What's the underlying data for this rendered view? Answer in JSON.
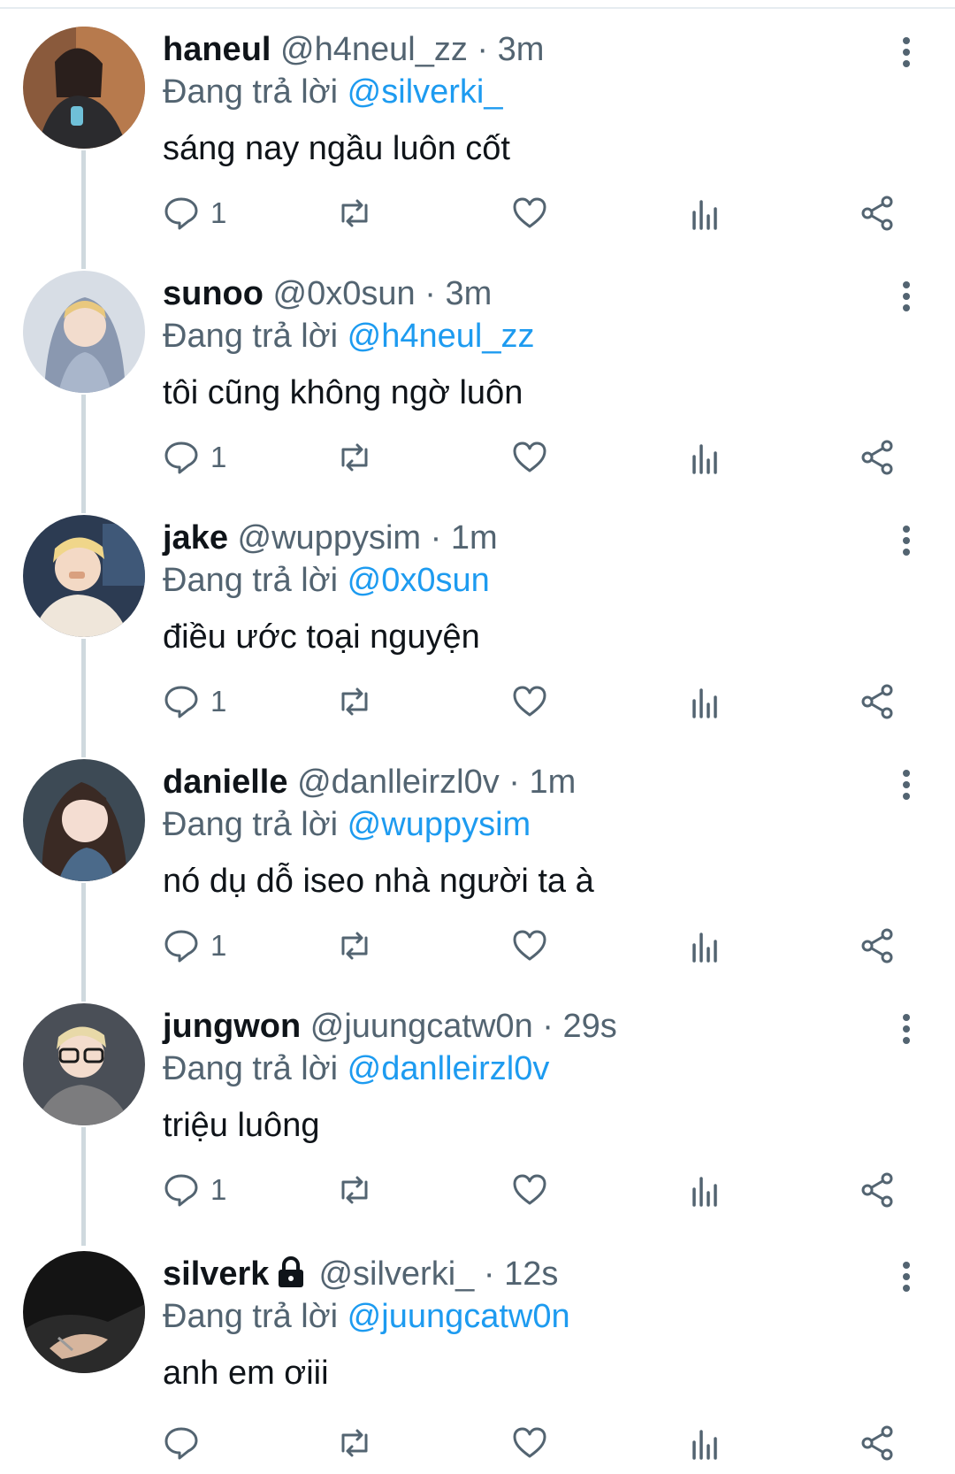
{
  "colors": {
    "accent": "#1d9bf0",
    "secondary_text": "#536471",
    "thread_line": "#cfd9de"
  },
  "icons": {
    "reply": "speech-bubble-icon",
    "retweet": "retweet-icon",
    "like": "heart-icon",
    "views": "bar-chart-icon",
    "share": "share-icon",
    "more": "vertical-dots-icon",
    "lock": "lock-icon"
  },
  "replying_prefix": "Đang trả lời",
  "replies": [
    {
      "name": "haneul",
      "handle": "@h4neul_zz",
      "sep": "·",
      "time": "3m",
      "replying_to": "@silverki_",
      "text": "sáng nay ngầu luôn cốt",
      "reply_count": "1"
    },
    {
      "name": "sunoo",
      "handle": "@0x0sun",
      "sep": "·",
      "time": "3m",
      "replying_to": "@h4neul_zz",
      "text": "tôi cũng không ngờ luôn",
      "reply_count": "1"
    },
    {
      "name": "jake",
      "handle": "@wuppysim",
      "sep": "·",
      "time": "1m",
      "replying_to": "@0x0sun",
      "text": "điều ước toại nguyện",
      "reply_count": "1"
    },
    {
      "name": "danielle",
      "handle": "@danlleirzl0v",
      "sep": "·",
      "time": "1m",
      "replying_to": "@wuppysim",
      "text": "nó dụ dỗ iseo nhà người ta à",
      "reply_count": "1"
    },
    {
      "name": "jungwon",
      "handle": "@juungcatw0n",
      "sep": "·",
      "time": "29s",
      "replying_to": "@danlleirzl0v",
      "text": "triệu luông",
      "reply_count": "1"
    },
    {
      "name": "silverk",
      "handle": "@silverki_",
      "sep": "·",
      "time": "12s",
      "replying_to": "@juungcatw0n",
      "text": "anh em ơiii",
      "reply_count": ""
    }
  ]
}
